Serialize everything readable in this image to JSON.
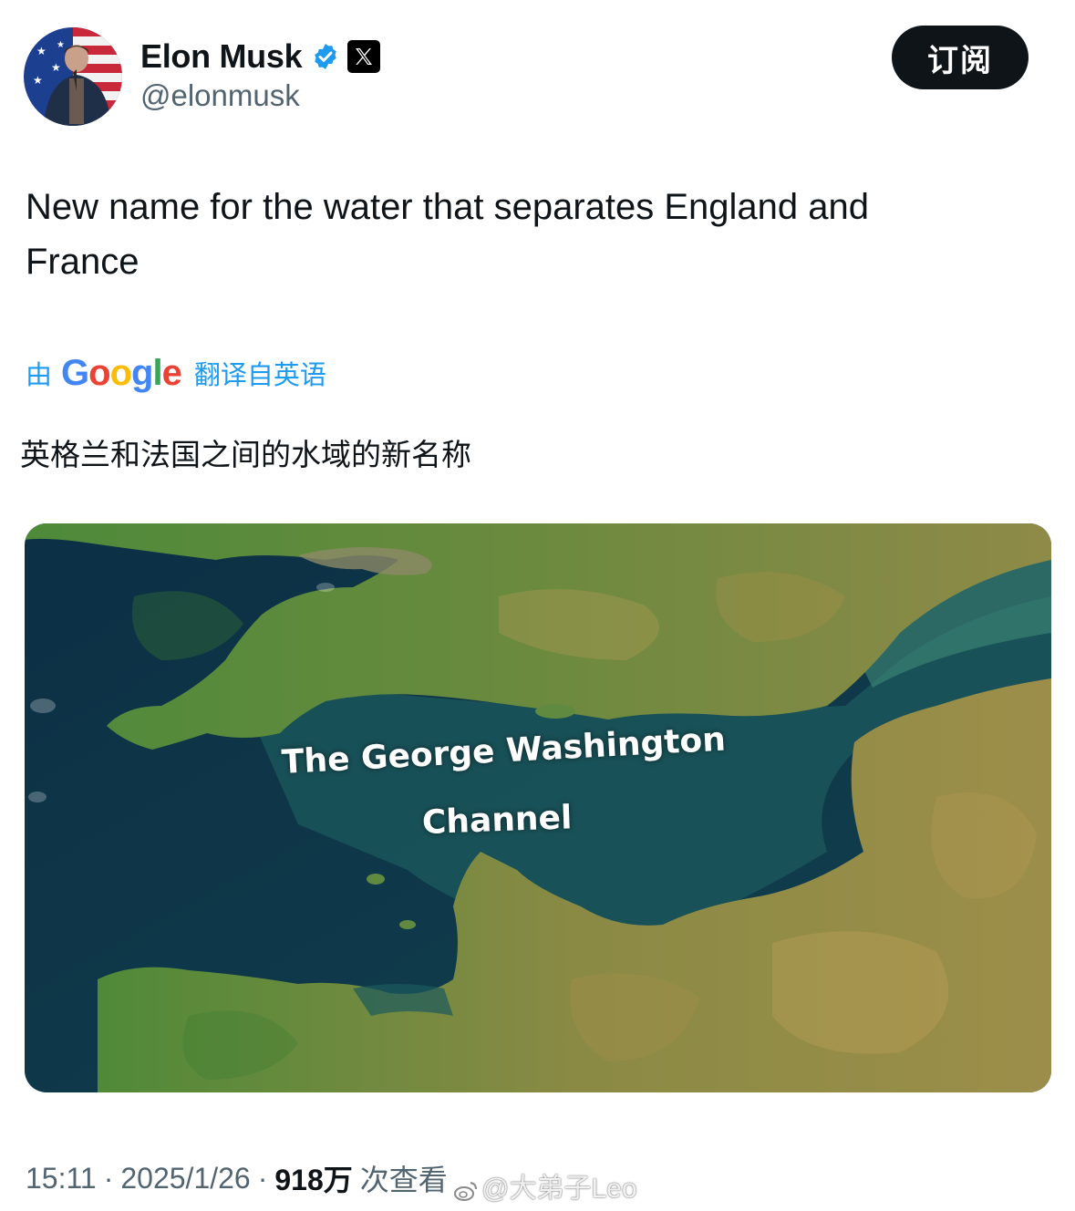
{
  "author": {
    "display_name": "Elon Musk",
    "handle": "@elonmusk",
    "verified_icon": "verified-badge-icon",
    "affiliate_icon": "x-logo-icon"
  },
  "subscribe_button": {
    "label": "订阅"
  },
  "tweet": {
    "text": "New name for the water that separates England and France"
  },
  "translation": {
    "prefix": "由",
    "provider": "Google",
    "suffix": "翻译自英语",
    "text": "英格兰和法国之间的水域的新名称"
  },
  "media": {
    "overlay_line_1": "The George Washington",
    "overlay_line_2": "Channel"
  },
  "footer": {
    "time": "15:11",
    "separator": "·",
    "date": "2025/1/26",
    "views": "918万",
    "views_label": "次查看"
  },
  "watermark": {
    "text": "@大弟子Leo"
  },
  "colors": {
    "accent": "#1d9bf0",
    "text_primary": "#0f1419",
    "text_secondary": "#536471",
    "button_bg": "#0f1419"
  }
}
